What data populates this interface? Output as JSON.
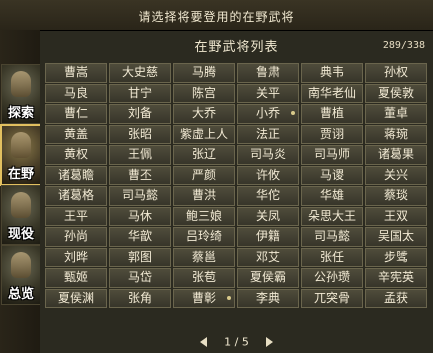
{
  "header": {
    "prompt": "请选择将要登用的在野武将"
  },
  "sidebar": {
    "tabs": [
      {
        "label": "探索"
      },
      {
        "label": "在野"
      },
      {
        "label": "现役"
      },
      {
        "label": "总览"
      }
    ],
    "active": "在野"
  },
  "panel": {
    "title": "在野武将列表",
    "count": "289/338"
  },
  "generals": [
    "曹嵩",
    "大史慈",
    "马腾",
    "鲁肃",
    "典韦",
    "孙权",
    "马良",
    "甘宁",
    "陈宫",
    "关平",
    "南华老仙",
    "夏侯敦",
    "曹仁",
    "刘备",
    "大乔",
    "小乔",
    "曹植",
    "董卓",
    "黄盖",
    "张昭",
    "紫虚上人",
    "法正",
    "贾诩",
    "蒋琬",
    "黄权",
    "王佩",
    "张辽",
    "司马炎",
    "司马师",
    "诸葛果",
    "诸葛瞻",
    "曹丕",
    "严颜",
    "许攸",
    "马谡",
    "关兴",
    "诸葛格",
    "司马懿",
    "曹洪",
    "华佗",
    "华雄",
    "蔡琰",
    "王平",
    "马休",
    "鲍三娘",
    "关凤",
    "朵思大王",
    "王双",
    "孙尚",
    "华歆",
    "吕玲绮",
    "伊籍",
    "司马懿",
    "吴国太",
    "刘晔",
    "郭图",
    "蔡邕",
    "邓艾",
    "张任",
    "步骘",
    "甄姬",
    "马岱",
    "张苞",
    "夏侯霸",
    "公孙瓒",
    "辛宪英",
    "夏侯渊",
    "张角",
    "曹彰",
    "李典",
    "兀突骨",
    "孟获"
  ],
  "marked": [
    15,
    68
  ],
  "pager": {
    "text": "1 / 5"
  }
}
